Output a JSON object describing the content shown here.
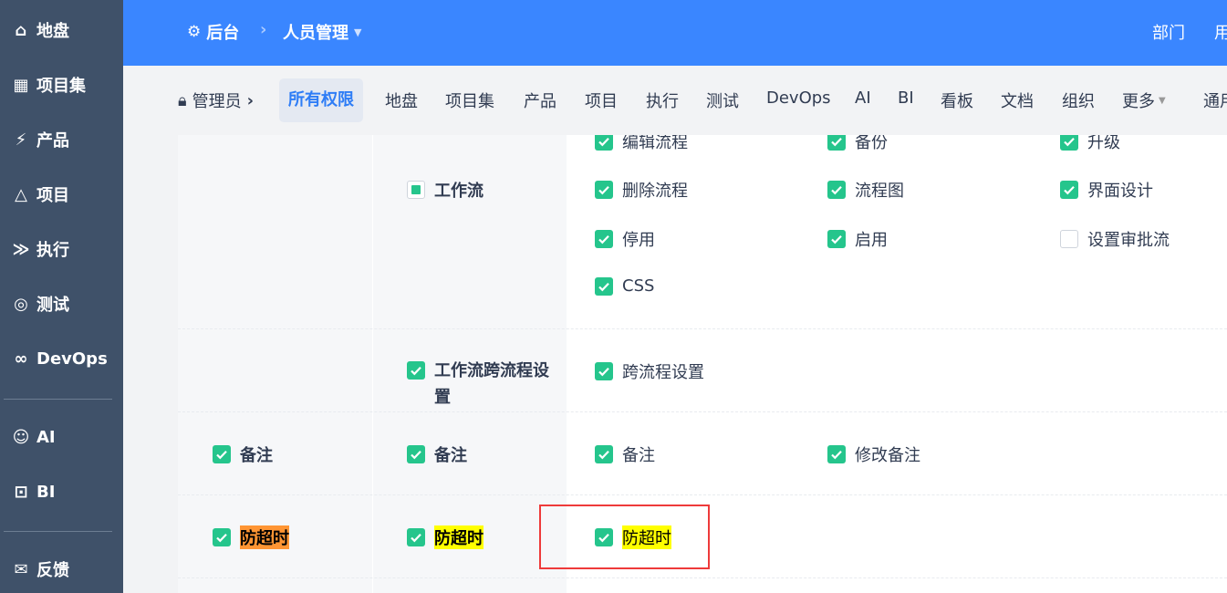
{
  "sidebar": {
    "items": [
      {
        "label": "地盘",
        "icon": "home-icon"
      },
      {
        "label": "项目集",
        "icon": "grid-icon"
      },
      {
        "label": "产品",
        "icon": "bulb-icon"
      },
      {
        "label": "项目",
        "icon": "rocket-icon"
      },
      {
        "label": "执行",
        "icon": "run-icon"
      },
      {
        "label": "测试",
        "icon": "test-icon"
      },
      {
        "label": "DevOps",
        "icon": "infinity-icon"
      },
      {
        "label": "AI",
        "icon": "robot-icon"
      },
      {
        "label": "BI",
        "icon": "chart-icon"
      },
      {
        "label": "反馈",
        "icon": "feedback-icon"
      }
    ]
  },
  "header": {
    "home": "后台",
    "section": "人员管理",
    "right": [
      "部门",
      "用"
    ]
  },
  "subnav": {
    "crumb": "管理员",
    "active": "所有权限",
    "tabs": [
      "地盘",
      "项目集",
      "产品",
      "项目",
      "执行",
      "测试",
      "DevOps",
      "AI",
      "BI",
      "看板",
      "文档",
      "组织",
      "更多",
      "通用"
    ]
  },
  "rows": {
    "workflow": {
      "label": "工作流",
      "perms": [
        {
          "label": "编辑流程",
          "checked": true
        },
        {
          "label": "备份",
          "checked": true
        },
        {
          "label": "升级",
          "checked": true
        },
        {
          "label": "删除流程",
          "checked": true
        },
        {
          "label": "流程图",
          "checked": true
        },
        {
          "label": "界面设计",
          "checked": true
        },
        {
          "label": "停用",
          "checked": true
        },
        {
          "label": "启用",
          "checked": true
        },
        {
          "label": "设置审批流",
          "checked": false
        },
        {
          "label": "CSS",
          "checked": true
        }
      ]
    },
    "crossflow": {
      "label": "工作流跨流程设置",
      "perms": [
        {
          "label": "跨流程设置",
          "checked": true
        }
      ]
    },
    "note": {
      "module": "备注",
      "label": "备注",
      "perms": [
        {
          "label": "备注",
          "checked": true
        },
        {
          "label": "修改备注",
          "checked": true
        }
      ]
    },
    "timeout": {
      "module": "防超时",
      "label": "防超时",
      "perms": [
        {
          "label": "防超时",
          "checked": true
        }
      ]
    }
  },
  "colors": {
    "accent": "#3a86ff",
    "check": "#25c58c",
    "highlight": "#ffff00",
    "highlight_orange": "#ff9533"
  }
}
